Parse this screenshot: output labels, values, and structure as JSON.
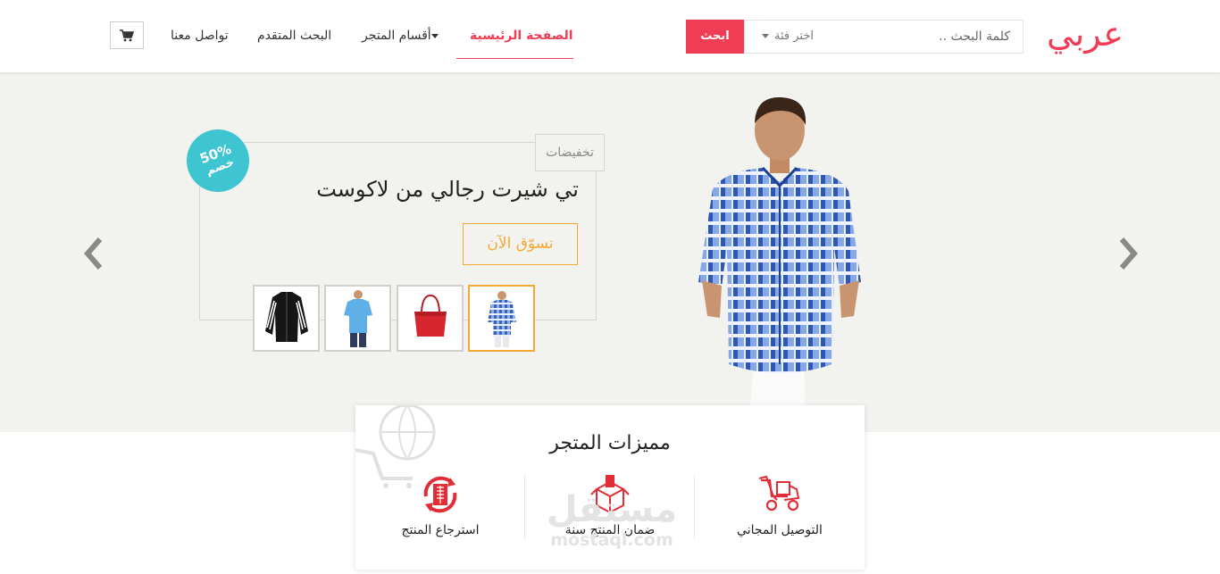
{
  "header": {
    "logo": "عربي",
    "search": {
      "placeholder": "كلمة البحث ..",
      "category": "اختر فئة",
      "button": "ابحث"
    },
    "nav": {
      "home": "الصفحة الرئيسية",
      "sections": "أقسام المتجر",
      "advanced_search": "البحث المتقدم",
      "contact": "تواصل معنا"
    },
    "cart_icon": "cart-icon"
  },
  "hero": {
    "tag": "تخفيضات",
    "discount": {
      "percent": "50%",
      "word": "خصم"
    },
    "title": "تي شيرت رجالي من لاكوست",
    "shop_button": "تسوّق الآن",
    "thumbnails": [
      "plaid-shirt",
      "red-handbag",
      "blue-polo",
      "black-jacket"
    ],
    "selected_thumbnail": "plaid-shirt",
    "prev_icon": "chevron-left-icon",
    "next_icon": "chevron-right-icon"
  },
  "features": {
    "title": "مميزات المتجر",
    "items": [
      {
        "label": "التوصيل المجاني",
        "icon": "delivery-truck-icon"
      },
      {
        "label": "ضمان المنتج سنة",
        "icon": "box-icon"
      },
      {
        "label": "استرجاع المنتج",
        "icon": "return-icon"
      }
    ]
  },
  "watermark": {
    "arabic": "مستقل",
    "latin": "mostaql.com"
  },
  "colors": {
    "accent": "#f03c54",
    "orange": "#f5a833",
    "teal": "#3fc4d1",
    "hero_bg": "#f2f2ef"
  }
}
